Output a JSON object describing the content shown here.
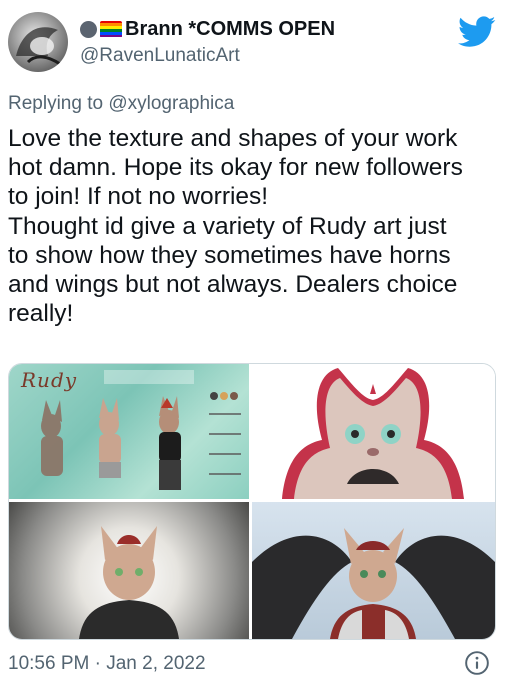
{
  "header": {
    "display_name": "Brann *COMMS OPEN",
    "handle": "@RavenLunaticArt",
    "icons": [
      "gray-circle-icon",
      "rainbow-flag-icon",
      "twitter-bird-icon"
    ],
    "brand_color": "#1d9bf0"
  },
  "reply": {
    "prefix": "Replying to",
    "mention": "@xylographica"
  },
  "tweet": {
    "lines": [
      "Love the texture and shapes of your work",
      "hot damn. Hope its okay for new followers",
      "to join! If not no worries!",
      "Thought id give a variety of Rudy art just",
      "to show how they sometimes have horns",
      "and wings but not always. Dealers choice",
      "really!"
    ]
  },
  "media": {
    "sheet_title": "Rudy",
    "images": [
      "reference-sheet-image",
      "sticker-portrait-image",
      "sketch-portrait-image",
      "winged-portrait-image"
    ]
  },
  "footer": {
    "timestamp": "10:56 PM · Jan 2, 2022",
    "info_icon": "info-icon"
  }
}
